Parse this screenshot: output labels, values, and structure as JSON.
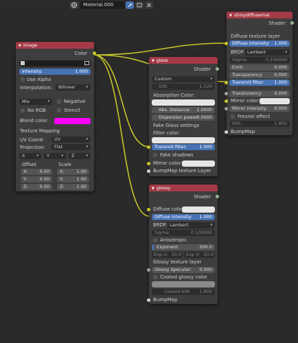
{
  "header": {
    "material_name": "Material.000",
    "icons": [
      "world-icon",
      "close-icon",
      "pin-icon"
    ]
  },
  "image_node": {
    "title": "Image",
    "color_output": "Color",
    "intensity_label": "Intensity:",
    "intensity_value": "1.000",
    "use_alpha": "Use Alpha",
    "interpolation_label": "Interpolation:",
    "interpolation_value": "Bilinear",
    "blend_mode": "Mix",
    "negative": "Negative",
    "no_rgb": "No RGB",
    "stencil": "Stencil",
    "blend_color_label": "Blend color:",
    "blend_color": "#ff00ff",
    "texture_mapping": "Texture Mapping",
    "uv_coord_label": "UV Coord:",
    "uv_coord_value": "UV",
    "projection_label": "Projection:",
    "projection_value": "Flat",
    "axis_x": "X",
    "axis_y": "Y",
    "axis_z": "Z",
    "offset_label": "Offset",
    "scale_label": "Scale",
    "offset_x": "0.00",
    "offset_y": "0.00",
    "offset_z": "0.00",
    "scale_x": "1.00",
    "scale_y": "1.00",
    "scale_z": "1.00",
    "x_label": "X:",
    "y_label": "Y:",
    "z_label": "Z:"
  },
  "glass_node": {
    "title": "glass",
    "shader": "Shader",
    "preset": "Custom",
    "ior_label": "IOR:",
    "ior_value": "1.520",
    "absorption_color": "Absorption Color:",
    "abs_distance_label": "Abs. Distance:",
    "abs_distance_value": "1.0000",
    "dispersion_label": "Dispersion power:",
    "dispersion_value": "0.0000",
    "fake_glass": "Fake Glass settings",
    "filter_color": "Filter color:",
    "transmit_label": "Transmit filter:",
    "transmit_value": "1.000",
    "fake_shadows": "Fake shadows",
    "mirror_color": "Mirror color:",
    "bumpmap_layer": "BumpMap texture Layer"
  },
  "shiny_node": {
    "title": "shinydiffusemat",
    "shader": "Shader",
    "diffuse_layer": "Diffuse texture layer",
    "diffuse_intensity_label": "Diffuse intensity:",
    "diffuse_intensity_value": "1.000",
    "brdf_label": "BRDF:",
    "brdf_value": "Lambert",
    "sigma_label": "Sigma:",
    "sigma_value": "0.100000",
    "emit_label": "Emit:",
    "emit_value": "0.000",
    "transparency_label": "Transparency:",
    "transparency_value": "0.000",
    "transmit_label": "Transmit filter:",
    "transmit_value": "1.000",
    "translucency_label": "Translucency:",
    "translucency_value": "0.000",
    "mirror_color": "Mirror color:",
    "mirror_intensity_label": "Mirror intensity:",
    "mirror_intensity_value": "0.000",
    "fresnel": "Fresnel effect",
    "ior_label": "IOR:",
    "ior_value": "1.800",
    "bumpmap": "BumpMap"
  },
  "glossy_node": {
    "title": "glossy",
    "shader": "Shader",
    "diffuse_color": "Diffuse color:",
    "diffuse_intensity_label": "Diffuse intensity:",
    "diffuse_intensity_value": "1.000",
    "brdf_label": "BRDF:",
    "brdf_value": "Lambert",
    "sigma_label": "Sigma:",
    "sigma_value": "0.100000",
    "anisotropic": "Anisotropic",
    "exponent_label": "Exponent:",
    "exponent_value": "500.0",
    "exp_u_label": "Exp U:",
    "exp_u_value": "50.0",
    "exp_v_label": "Exp V:",
    "exp_v_value": "50.0",
    "glossy_layer": "Glossy texture layer",
    "glossy_specular_label": "Glossy Specular:",
    "glossy_specular_value": "0.000",
    "coated": "Coated glossy color",
    "coated_ior_label": "Coated IOR:",
    "coated_ior_value": "1.800",
    "bumpmap": "BumpMap"
  }
}
